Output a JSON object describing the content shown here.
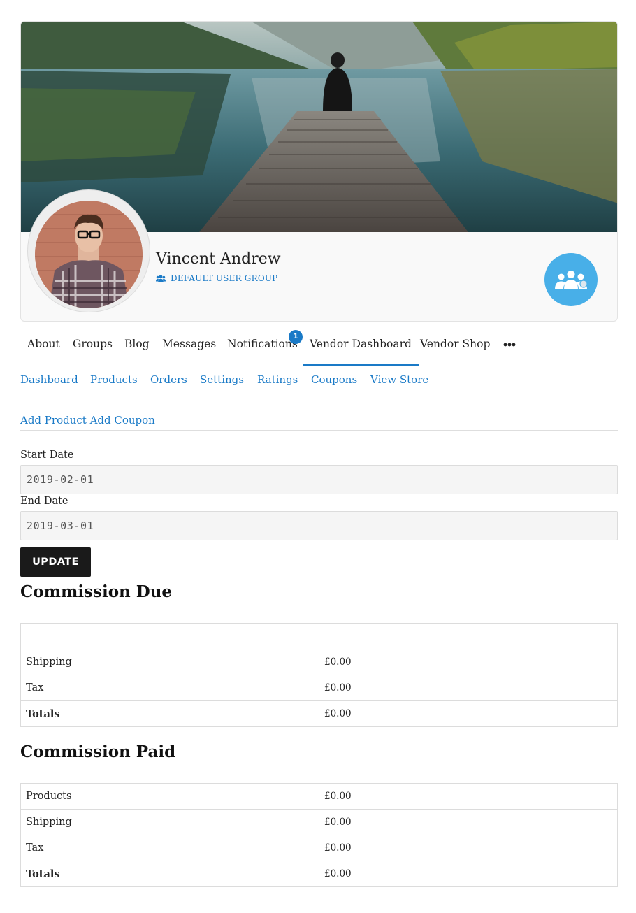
{
  "profile": {
    "name": "Vincent Andrew",
    "group": "DEFAULT USER GROUP"
  },
  "primary_nav": {
    "items": [
      {
        "label": "About"
      },
      {
        "label": "Groups"
      },
      {
        "label": "Blog"
      },
      {
        "label": "Messages"
      },
      {
        "label": "Notifications",
        "badge": "1"
      },
      {
        "label": "Vendor Dashboard",
        "active": true
      },
      {
        "label": "Vendor Shop"
      }
    ],
    "more_icon": "more-dots-icon"
  },
  "sub_nav": {
    "items": [
      {
        "label": "Dashboard"
      },
      {
        "label": "Products"
      },
      {
        "label": "Orders"
      },
      {
        "label": "Settings"
      },
      {
        "label": "Ratings"
      },
      {
        "label": "Coupons"
      },
      {
        "label": "View Store"
      }
    ]
  },
  "actions": {
    "add_product": "Add Product",
    "add_coupon": "Add Coupon"
  },
  "form": {
    "start_label": "Start Date",
    "start_value": "2019-02-01",
    "end_label": "End Date",
    "end_value": "2019-03-01",
    "update_label": "UPDATE"
  },
  "commission_due": {
    "title": "Commission Due",
    "rows": [
      {
        "label": "",
        "value": ""
      },
      {
        "label": "Shipping",
        "value": "£0.00"
      },
      {
        "label": "Tax",
        "value": "£0.00"
      },
      {
        "label": "Totals",
        "value": "£0.00"
      }
    ]
  },
  "commission_paid": {
    "title": "Commission Paid",
    "rows": [
      {
        "label": "Products",
        "value": "£0.00"
      },
      {
        "label": "Shipping",
        "value": "£0.00"
      },
      {
        "label": "Tax",
        "value": "£0.00"
      },
      {
        "label": "Totals",
        "value": "£0.00"
      }
    ]
  },
  "colors": {
    "accent": "#1a7ac7",
    "badge_blue": "#48afe8",
    "button_dark": "#1a1a1a"
  }
}
